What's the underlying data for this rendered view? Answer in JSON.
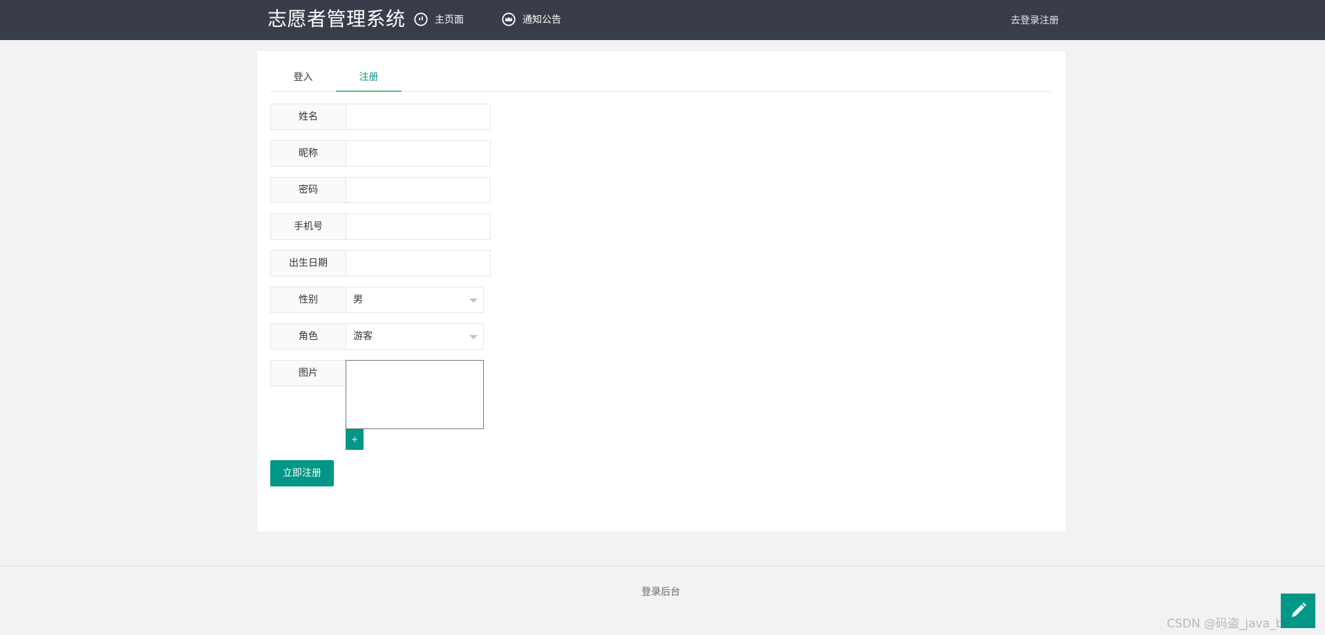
{
  "header": {
    "brand": "志愿者管理系统",
    "nav": [
      {
        "label": "主页面",
        "icon": "speedometer-icon"
      },
      {
        "label": "通知公告",
        "icon": "crown-icon"
      }
    ],
    "right_link": "去登录注册"
  },
  "tabs": [
    {
      "label": "登入",
      "active": false
    },
    {
      "label": "注册",
      "active": true
    }
  ],
  "form": {
    "fields": [
      {
        "label": "姓名",
        "value": "",
        "placeholder": ""
      },
      {
        "label": "昵称",
        "value": "",
        "placeholder": ""
      },
      {
        "label": "密码",
        "value": "",
        "placeholder": ""
      },
      {
        "label": "手机号",
        "value": "",
        "placeholder": ""
      },
      {
        "label": "出生日期",
        "value": "",
        "placeholder": ""
      }
    ],
    "gender": {
      "label": "性别",
      "value": "男"
    },
    "role": {
      "label": "角色",
      "value": "游客"
    },
    "image": {
      "label": "图片",
      "add_label": "+"
    },
    "submit_label": "立即注册"
  },
  "footer": {
    "link": "登录后台"
  },
  "watermark": "CSDN @码盗_java_bishe",
  "colors": {
    "topbar": "#393d49",
    "accent": "#009688",
    "tab_underline": "#5fb878"
  },
  "icons": {
    "fab": "pencil-icon"
  }
}
